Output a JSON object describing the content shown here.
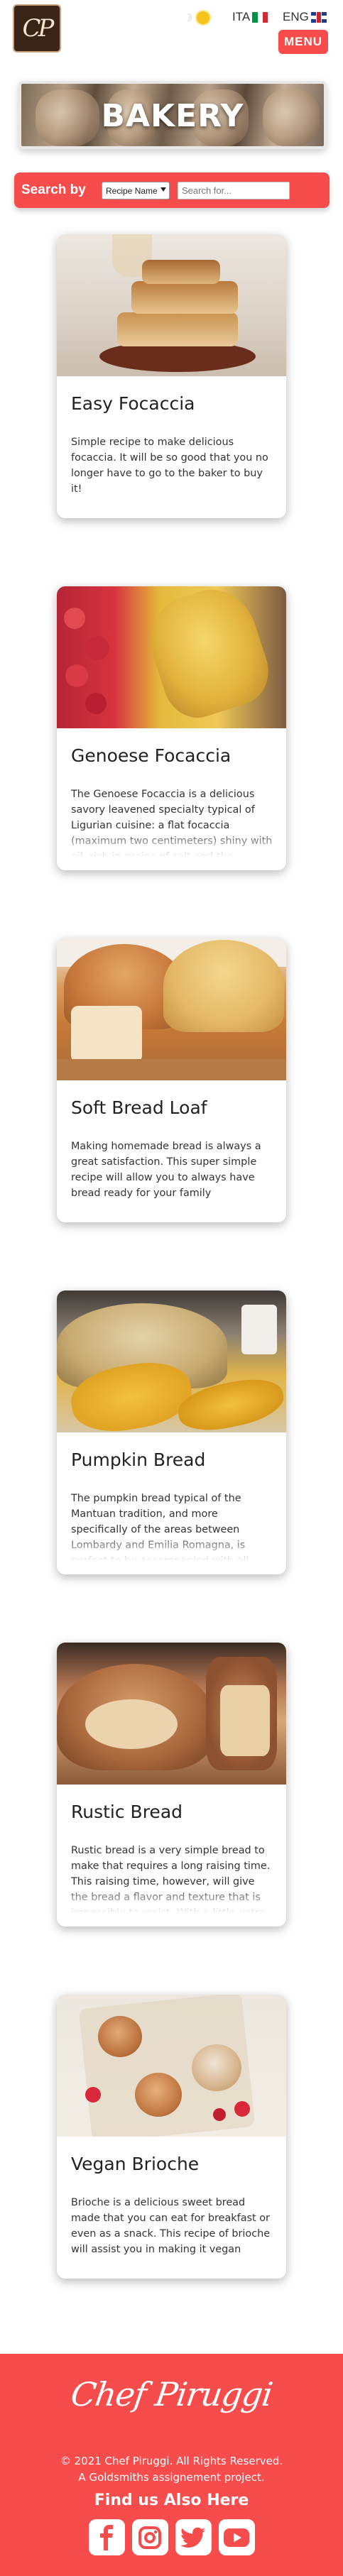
{
  "header": {
    "logo_text": "CP",
    "mode_moon": "☽",
    "lang_ita": "ITA",
    "lang_eng": "ENG",
    "menu_label": "MENU"
  },
  "banner": {
    "title": "BAKERY"
  },
  "search": {
    "label": "Search by",
    "select_value": "Recipe Name",
    "placeholder": "Search for..."
  },
  "recipes": [
    {
      "title": "Easy Focaccia",
      "description": "Simple recipe to make delicious focaccia. It will be so good that you no longer have to go to the baker to buy it!"
    },
    {
      "title": "Genoese Focaccia",
      "description": "The Genoese Focaccia is a delicious savory leavened specialty typical of Ligurian cuisine: a flat focaccia (maximum two centimeters) shiny with oil, rich in grains of salt and the characteristic deep holes on the"
    },
    {
      "title": "Soft Bread Loaf",
      "description": "Making homemade bread is always a great satisfaction. This super simple recipe will allow you to always have bread ready for your family"
    },
    {
      "title": "Pumpkin Bread",
      "description": "The pumpkin bread typical of the Mantuan tradition, and more specifically of the areas between Lombardy and Emilia Romagna, is perfect to be accompanied with all kinds of cold cuts but also with"
    },
    {
      "title": "Rustic Bread",
      "description": "Rustic bread is a very simple bread to make that requires a long raising time. This raising time, however, will give the bread a flavor and texture that is impossible to resist. With a little extra virgin olive oil or Nutella, this bread"
    },
    {
      "title": "Vegan Brioche",
      "description": "Brioche is a delicious sweet bread made that you can eat for breakfast or even as a snack. This recipe of brioche will assist you in making it vegan"
    }
  ],
  "footer": {
    "signature": "Chef Piruggi",
    "copyright_line1": "© 2021 Chef Piruggi. All Rights Reserved.",
    "copyright_line2": "A Goldsmiths assignement project.",
    "find_us": "Find us Also Here",
    "social_icons": [
      "facebook-icon",
      "instagram-icon",
      "twitter-icon",
      "youtube-icon"
    ]
  },
  "colors": {
    "accent": "#f64c4c",
    "flag_green": "#009246",
    "flag_red": "#ce2b37"
  }
}
